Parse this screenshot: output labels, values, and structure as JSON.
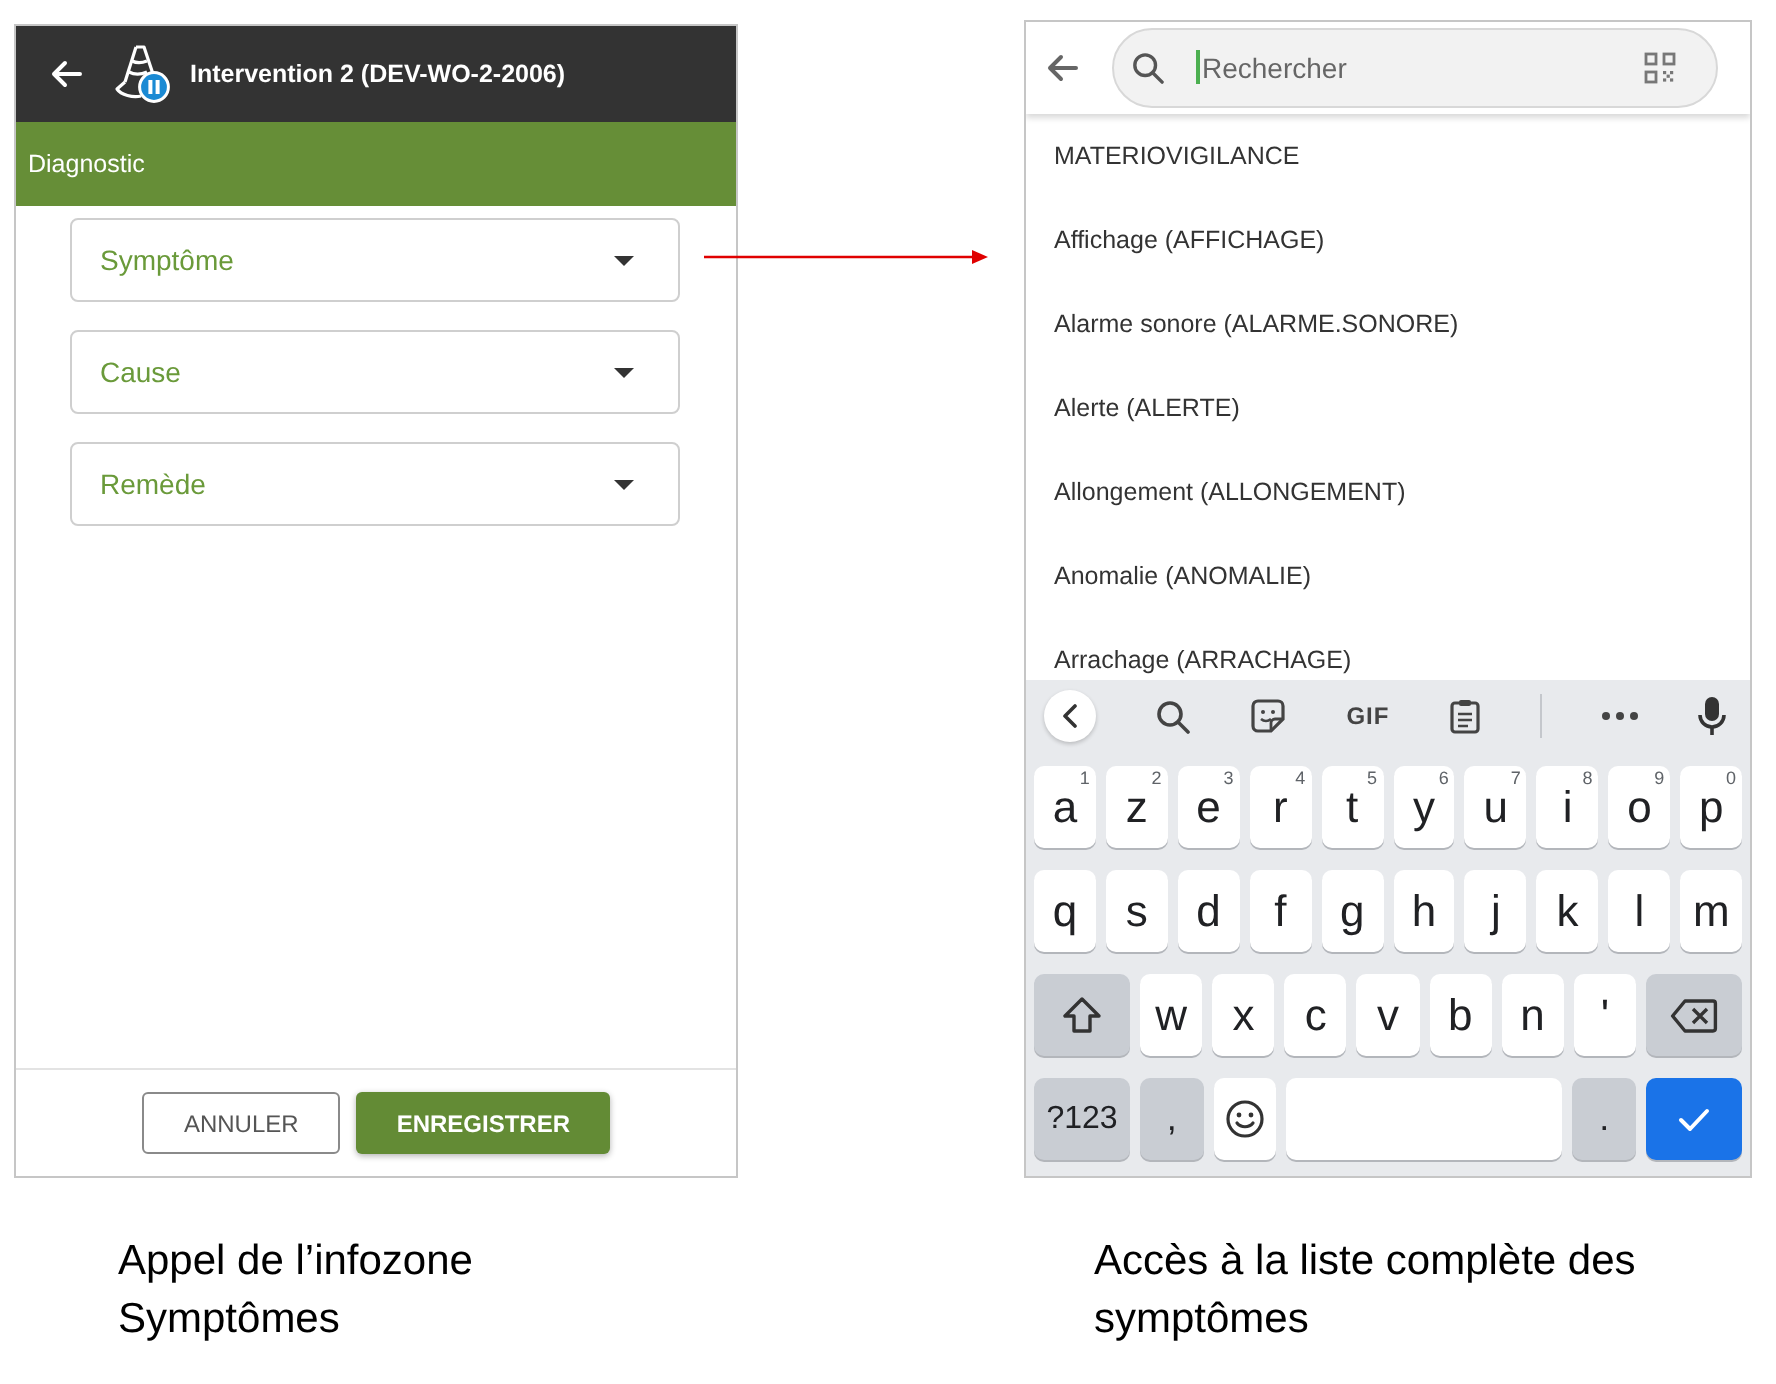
{
  "left_screen": {
    "app_bar": {
      "title": "Intervention 2 (DEV-WO-2-2006)"
    },
    "section": {
      "title": "Diagnostic"
    },
    "fields": [
      {
        "label": "Symptôme"
      },
      {
        "label": "Cause"
      },
      {
        "label": "Remède"
      }
    ],
    "buttons": [
      {
        "label": "ANNULER",
        "kind": "outlined"
      },
      {
        "label": "ENREGISTRER",
        "kind": "filled"
      }
    ]
  },
  "right_screen": {
    "search": {
      "placeholder": "Rechercher",
      "focused": true
    },
    "items": [
      "MATERIOVIGILANCE",
      "Affichage (AFFICHAGE)",
      "Alarme sonore (ALARME.SONORE)",
      "Alerte (ALERTE)",
      "Allongement (ALLONGEMENT)",
      "Anomalie (ANOMALIE)",
      "Arrachage (ARRACHAGE)"
    ],
    "keyboard": {
      "toolbar": {
        "gif": "GIF"
      },
      "rows": [
        [
          {
            "kind": "letter",
            "label": "a",
            "hint": "1"
          },
          {
            "kind": "letter",
            "label": "z",
            "hint": "2"
          },
          {
            "kind": "letter",
            "label": "e",
            "hint": "3"
          },
          {
            "kind": "letter",
            "label": "r",
            "hint": "4"
          },
          {
            "kind": "letter",
            "label": "t",
            "hint": "5"
          },
          {
            "kind": "letter",
            "label": "y",
            "hint": "6"
          },
          {
            "kind": "letter",
            "label": "u",
            "hint": "7"
          },
          {
            "kind": "letter",
            "label": "i",
            "hint": "8"
          },
          {
            "kind": "letter",
            "label": "o",
            "hint": "9"
          },
          {
            "kind": "letter",
            "label": "p",
            "hint": "0"
          }
        ],
        [
          {
            "kind": "letter",
            "label": "q"
          },
          {
            "kind": "letter",
            "label": "s"
          },
          {
            "kind": "letter",
            "label": "d"
          },
          {
            "kind": "letter",
            "label": "f"
          },
          {
            "kind": "letter",
            "label": "g"
          },
          {
            "kind": "letter",
            "label": "h"
          },
          {
            "kind": "letter",
            "label": "j"
          },
          {
            "kind": "letter",
            "label": "k"
          },
          {
            "kind": "letter",
            "label": "l"
          },
          {
            "kind": "letter",
            "label": "m"
          }
        ],
        [
          {
            "kind": "shift"
          },
          {
            "kind": "letter",
            "label": "w"
          },
          {
            "kind": "letter",
            "label": "x"
          },
          {
            "kind": "letter",
            "label": "c"
          },
          {
            "kind": "letter",
            "label": "v"
          },
          {
            "kind": "letter",
            "label": "b"
          },
          {
            "kind": "letter",
            "label": "n"
          },
          {
            "kind": "letter",
            "label": "'"
          },
          {
            "kind": "backspace"
          }
        ],
        [
          {
            "kind": "symbols",
            "label": "?123"
          },
          {
            "kind": "punct",
            "label": ","
          },
          {
            "kind": "emoji"
          },
          {
            "kind": "space"
          },
          {
            "kind": "punct",
            "label": "."
          },
          {
            "kind": "enter"
          }
        ]
      ]
    }
  },
  "captions": [
    "Appel de l’infozone Symptômes",
    "Accès à la liste complète des symptômes"
  ]
}
